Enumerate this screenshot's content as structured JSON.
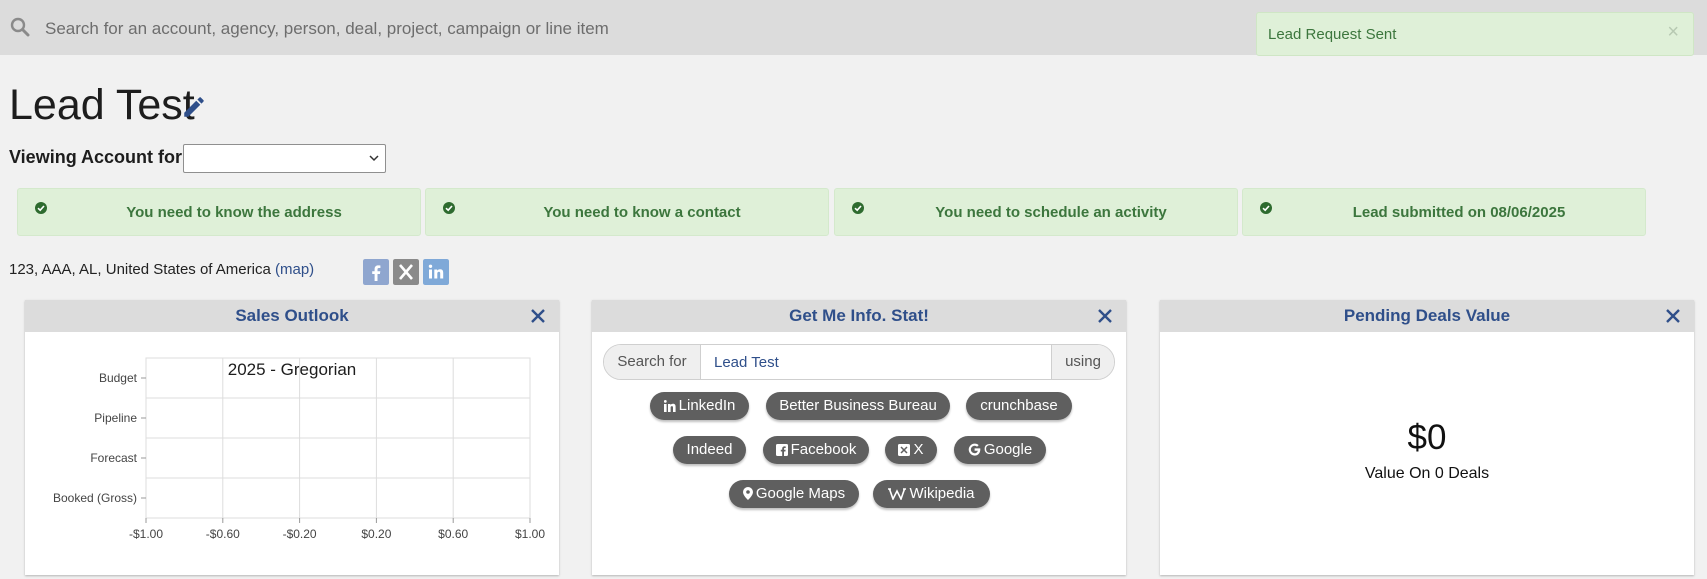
{
  "search": {
    "placeholder": "Search for an account, agency, person, deal, project, campaign or line item"
  },
  "toast": {
    "message": "Lead Request Sent",
    "close": "×"
  },
  "page": {
    "title": "Lead Test"
  },
  "viewing": {
    "label": "Viewing Account for:",
    "selected": ""
  },
  "checklist": [
    {
      "label": "You need to know the address"
    },
    {
      "label": "You need to know a contact"
    },
    {
      "label": "You need to schedule an activity"
    },
    {
      "label": "Lead submitted on 08/06/2025"
    }
  ],
  "address": {
    "text": "123, AAA, AL, United States of America",
    "map_link": "(map)"
  },
  "social": [
    {
      "icon": "facebook-icon",
      "color": "#8fa6cf"
    },
    {
      "icon": "x-icon",
      "color": "#8a8a8a"
    },
    {
      "icon": "linkedin-icon",
      "color": "#7fa9d8"
    }
  ],
  "panels": {
    "sales_outlook": {
      "title": "Sales Outlook"
    },
    "get_info": {
      "title": "Get Me Info. Stat!",
      "search_prefix": "Search for",
      "search_value": "Lead Test",
      "search_suffix": "using",
      "chips": [
        {
          "label": "LinkedIn",
          "icon": "linkedin-icon"
        },
        {
          "label": "Better Business Bureau",
          "icon": ""
        },
        {
          "label": "crunchbase",
          "icon": ""
        },
        {
          "label": "Indeed",
          "icon": ""
        },
        {
          "label": "Facebook",
          "icon": "facebook-icon"
        },
        {
          "label": "X",
          "icon": "x-icon"
        },
        {
          "label": "Google",
          "icon": "google-icon"
        },
        {
          "label": "Google Maps",
          "icon": "map-pin-icon"
        },
        {
          "label": "Wikipedia",
          "icon": "wikipedia-icon"
        }
      ]
    },
    "pending_deals": {
      "title": "Pending Deals Value",
      "value": "$0",
      "caption": "Value On 0 Deals"
    }
  },
  "chart_data": {
    "type": "bar",
    "orientation": "horizontal",
    "title": "2025 - Gregorian",
    "categories": [
      "Budget",
      "Pipeline",
      "Forecast",
      "Booked (Gross)"
    ],
    "values": [
      0,
      0,
      0,
      0
    ],
    "x_ticks": [
      "-$1.00",
      "-$0.60",
      "-$0.20",
      "$0.20",
      "$0.60",
      "$1.00"
    ],
    "xlim": [
      -1,
      1
    ],
    "grid": true,
    "legend": "none"
  }
}
